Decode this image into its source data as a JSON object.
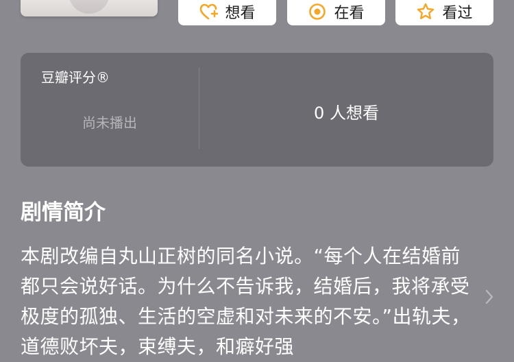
{
  "actions": {
    "want_label": "想看",
    "watching_label": "在看",
    "watched_label": "看过",
    "accent_color": "#f6a623"
  },
  "rating": {
    "label": "豆瓣评分®",
    "status": "尚未播出",
    "want_count_text": "0 人想看"
  },
  "synopsis": {
    "title": "剧情简介",
    "text": "本剧改编自丸山正树的同名小说。“每个人在结婚前都只会说好话。为什么不告诉我，结婚后，我将承受极度的孤独、生活的空虚和对未来的不安。”出轨夫，道德败坏夫，束缚夫，和癖好强"
  }
}
